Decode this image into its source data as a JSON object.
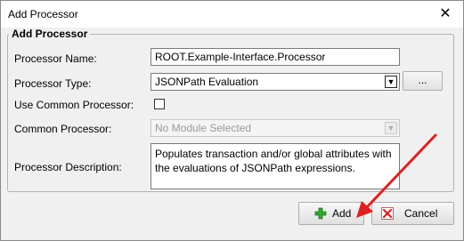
{
  "window": {
    "title": "Add Processor",
    "close_glyph": "✕"
  },
  "form": {
    "legend": "Add Processor",
    "name_label": "Processor Name:",
    "name_value": "ROOT.Example-Interface.Processor",
    "type_label": "Processor Type:",
    "type_value": "JSONPath Evaluation",
    "browse_label": "...",
    "use_common_label": "Use Common Processor:",
    "use_common_checked": false,
    "common_label": "Common Processor:",
    "common_value": "No Module Selected",
    "description_label": "Processor Description:",
    "description_value": "Populates transaction and/or global attributes with the evaluations of JSONPath expressions."
  },
  "buttons": {
    "add_label": "Add",
    "add_icon": "plus-icon",
    "cancel_label": "Cancel",
    "cancel_icon": "x-icon"
  },
  "colors": {
    "annotation_arrow": "#e02020",
    "add_icon_green": "#2ea82e",
    "cancel_icon_red": "#d42020"
  }
}
